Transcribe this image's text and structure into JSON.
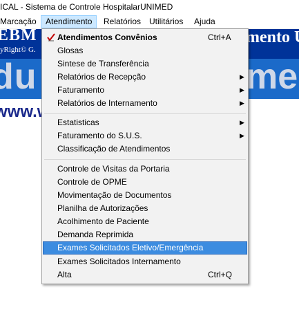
{
  "window": {
    "title": "ICAL - Sistema de Controle HospitalarUNIMED"
  },
  "menubar": {
    "items": [
      "Marcação",
      "Atendimento",
      "Relatórios",
      "Utilitários",
      "Ajuda"
    ]
  },
  "banner": {
    "left_big": "EBM",
    "left_small": "yRight© G.",
    "right_big": "mento U"
  },
  "band": {
    "left": "du",
    "right": "ment"
  },
  "url_text": "www.web",
  "menu": {
    "items": [
      {
        "label": "Atendimentos Convênios",
        "shortcut": "Ctrl+A",
        "bold": true,
        "icon": "check-icon"
      },
      {
        "label": "Glosas"
      },
      {
        "label": "Sintese de Transferência"
      },
      {
        "label": "Relatórios de Recepção",
        "submenu": true
      },
      {
        "label": "Faturamento",
        "submenu": true
      },
      {
        "label": "Relatórios de Internamento",
        "submenu": true
      },
      {
        "label": "Estatisticas",
        "submenu": true
      },
      {
        "label": "Faturamento do S.U.S.",
        "submenu": true
      },
      {
        "label": "Classificação de Atendimentos"
      },
      {
        "label": "Controle de Visitas da Portaria"
      },
      {
        "label": "Controle de OPME"
      },
      {
        "label": "Movimentação de Documentos"
      },
      {
        "label": "Planilha de Autorizações"
      },
      {
        "label": "Acolhimento de Paciente"
      },
      {
        "label": "Demanda Reprimida"
      },
      {
        "label": "Exames Solicitados Eletivo/Emergência",
        "highlighted": true
      },
      {
        "label": "Exames Solicitados Internamento"
      },
      {
        "label": "Alta",
        "shortcut": "Ctrl+Q"
      }
    ]
  },
  "colors": {
    "highlight": "#3c8ce0",
    "banner": "#003399",
    "band": "#1b6ac9"
  }
}
